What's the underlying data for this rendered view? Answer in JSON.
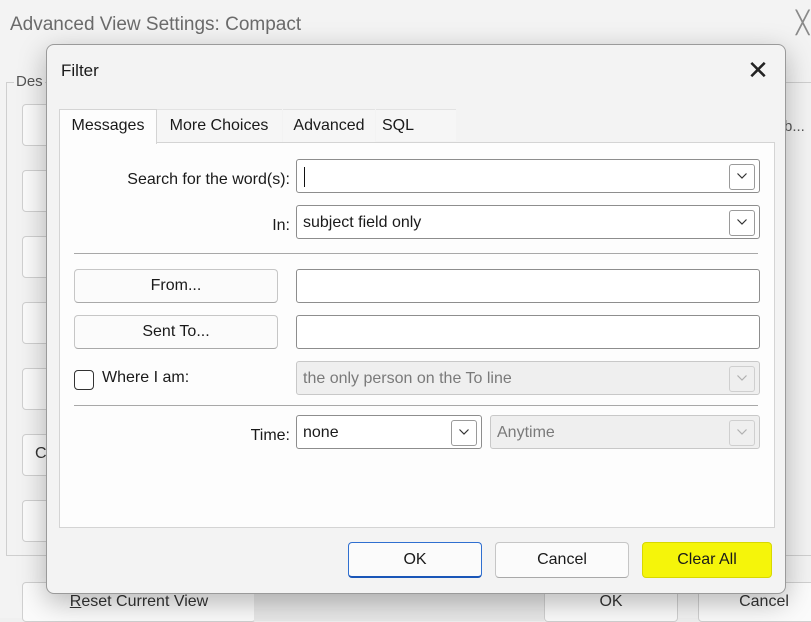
{
  "background_window": {
    "title": "Advanced View Settings: Compact",
    "group_label": "Des",
    "right_label": "b...",
    "side_button_partial": "C",
    "reset_label_first": "R",
    "reset_label_rest": "eset Current View",
    "ok_label": "OK",
    "cancel_label": "Cancel"
  },
  "dialog": {
    "title": "Filter",
    "tabs": [
      {
        "label": "Messages",
        "active": true
      },
      {
        "label": "More Choices",
        "active": false
      },
      {
        "label": "Advanced",
        "active": false
      },
      {
        "label": "SQL",
        "active": false
      }
    ],
    "search": {
      "label": "Search for the word(s):",
      "value": ""
    },
    "in": {
      "label": "In:",
      "value": "subject field only"
    },
    "from_button": "From...",
    "from_value": "",
    "sent_to_button": "Sent To...",
    "sent_to_value": "",
    "where_i_am": {
      "label": "Where I am:",
      "checked": false,
      "value": "the only person on the To line"
    },
    "time": {
      "label": "Time:",
      "value": "none",
      "range": "Anytime"
    },
    "buttons": {
      "ok": "OK",
      "cancel": "Cancel",
      "clear_all": "Clear All"
    },
    "highlight_color": "#f5f50a",
    "accent_color": "#2f6fd0"
  }
}
